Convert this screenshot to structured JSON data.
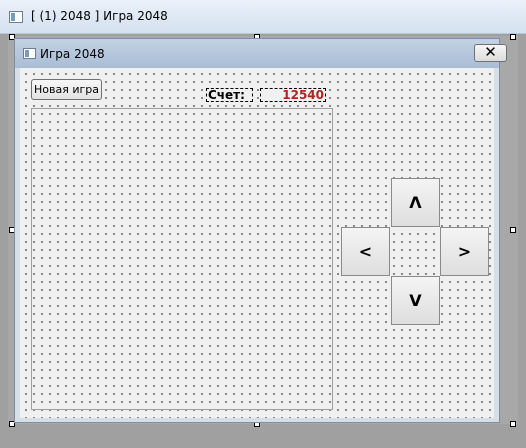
{
  "outer_window": {
    "title": "[ (1) 2048 ] Игра 2048",
    "icon": "form-icon"
  },
  "form": {
    "title": "Игра 2048",
    "close_label": "✕",
    "new_game_label": "Новая игра",
    "score_label": "Счет:",
    "score_value": "12540",
    "score_color": "#b22222",
    "buttons": {
      "up": "Λ",
      "left": "<",
      "right": ">",
      "down": "V"
    }
  }
}
